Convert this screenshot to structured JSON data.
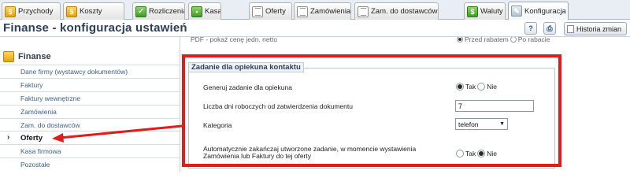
{
  "tabs": [
    {
      "label": "Przychody",
      "icon": "coins-icon"
    },
    {
      "label": "Koszty",
      "icon": "coins-icon"
    },
    {
      "label": "Rozliczenia",
      "icon": "settlement-icon"
    },
    {
      "label": "Kasa",
      "icon": "cash-register-icon"
    },
    {
      "label": "Oferty",
      "icon": "document-icon"
    },
    {
      "label": "Zamówienia",
      "icon": "document-icon"
    },
    {
      "label": "Zam. do dostawców",
      "icon": "document-icon"
    },
    {
      "label": "Waluty",
      "icon": "dollar-icon"
    },
    {
      "label": "Konfiguracja",
      "icon": "wrench-icon"
    }
  ],
  "header": {
    "title": "Finanse - konfiguracja ustawień",
    "history_button": "Historia zmian"
  },
  "partial_row": {
    "label": "PDF - pokaż cenę jedn. netto",
    "option_1": "Przed rabatem",
    "option_2": "Po rabacie"
  },
  "sidebar": {
    "title": "Finanse",
    "items": [
      {
        "label": "Dane firmy (wystawcy dokumentów)"
      },
      {
        "label": "Faktury"
      },
      {
        "label": "Faktury wewnętrzne"
      },
      {
        "label": "Zamówienia"
      },
      {
        "label": "Zam. do dostawców"
      },
      {
        "label": "Oferty"
      },
      {
        "label": "Kasa firmowa"
      },
      {
        "label": "Pozostałe"
      }
    ],
    "active_item": "Oferty"
  },
  "section": {
    "legend": "Zadanie dla opiekuna kontaktu",
    "generate_task": {
      "label": "Generuj zadanie dla opiekuna",
      "yes": "Tak",
      "no": "Nie",
      "selected": "Tak"
    },
    "working_days": {
      "label": "Liczba dni roboczych od zatwierdzenia dokumentu",
      "value": "7"
    },
    "category": {
      "label": "Kategoria",
      "value": "telefon"
    },
    "auto_complete": {
      "label_line1": "Automatycznie zakańczaj utworzone zadanie, w momencie wystawienia",
      "label_line2": "Zamówienia lub Faktury do tej oferty",
      "yes": "Tak",
      "no": "Nie",
      "selected": "Nie"
    }
  },
  "colors": {
    "annotation_red": "#e21b1b",
    "link_blue": "#3b5f8e",
    "title_navy": "#2f3f55"
  }
}
